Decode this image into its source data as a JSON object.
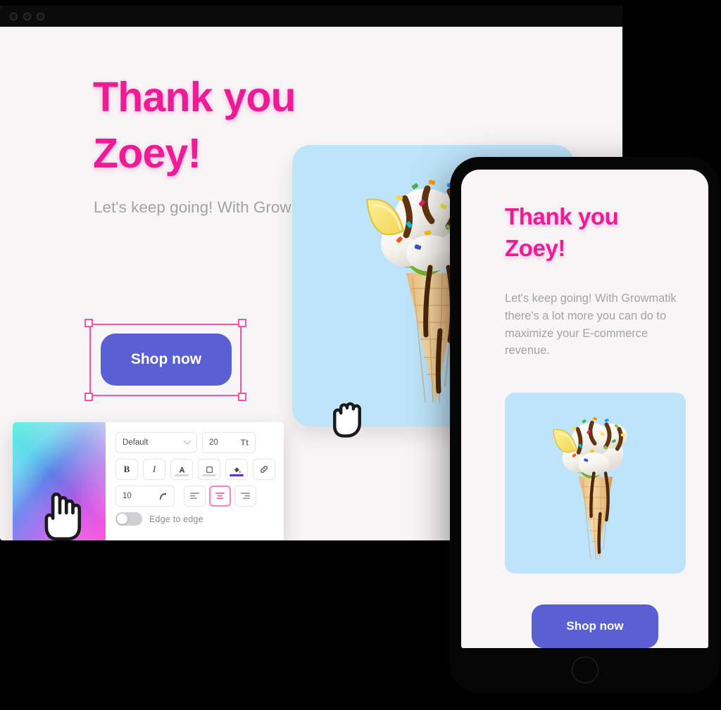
{
  "window": {
    "controls": [
      "close-dot",
      "minimize-dot",
      "maximize-dot"
    ]
  },
  "desktop_preview": {
    "heading": "Thank you Zoey!",
    "paragraph": "Let's keep going! With Growmatik there's a lot more you can do to maximize your E-commerce revenue.",
    "cta_label": "Shop now",
    "image_alt": "ice-cream-cone",
    "selection": {
      "active": true,
      "handles": [
        "top-left",
        "top-right",
        "bottom-left",
        "bottom-right"
      ],
      "color": "#ff4fa3"
    }
  },
  "mobile_preview": {
    "heading": "Thank you Zoey!",
    "paragraph": "Let's keep going! With Growmatik there's a lot more you can do to maximize your E-commerce revenue.",
    "cta_label": "Shop now",
    "image_alt": "ice-cream-cone"
  },
  "editor_panel": {
    "color_picker": {
      "name": "gradient-color-field",
      "corner_colors": {
        "top_left": "#3ee0c8",
        "top_right": "#fdf3c9",
        "bottom_left": "#1f3fe8",
        "bottom_right": "#f93ec0"
      }
    },
    "toolbar": {
      "font_family": {
        "label": "Default",
        "icon": "chevron-down-icon"
      },
      "font_size": {
        "value": "20",
        "icon": "font-size-icon",
        "icon_glyph": "Tt"
      },
      "bold": {
        "label": "B",
        "active": false
      },
      "italic": {
        "label": "I",
        "active": false
      },
      "text_color": {
        "icon": "text-color-icon",
        "swatch": "#d8d8dc"
      },
      "border": {
        "icon": "border-box-icon"
      },
      "fill_color": {
        "icon": "paint-bucket-icon",
        "swatch": "#5b2fe0"
      },
      "link": {
        "icon": "link-icon"
      },
      "corner_radius": {
        "value": "10",
        "icon": "corner-radius-icon"
      },
      "align": {
        "options": [
          "left",
          "center",
          "right"
        ],
        "selected": "center",
        "highlight_color": "#ff82bd"
      },
      "edge_to_edge": {
        "label": "Edge to edge",
        "enabled": false
      }
    }
  },
  "cursors": {
    "canvas": "grab-hand-cursor",
    "color_picker": "pointing-hand-cursor"
  },
  "colors": {
    "brand_pink": "#ef1a96",
    "cta_purple": "#5b5fd4",
    "image_bg_blue": "#bde4fa",
    "canvas_bg": "#f7f5f6",
    "body_text": "#a3a3a5"
  }
}
